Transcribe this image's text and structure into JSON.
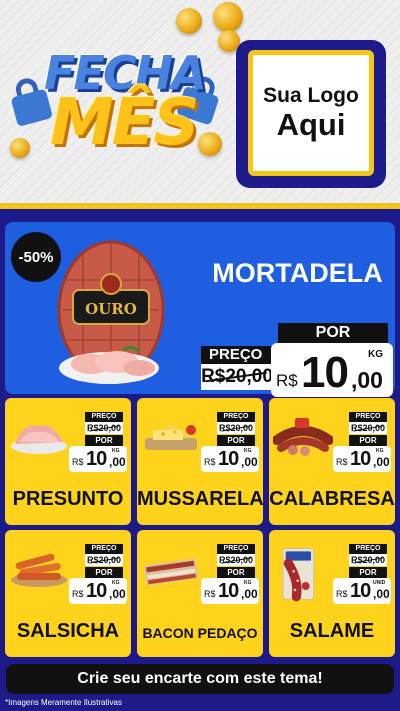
{
  "header": {
    "title_line1": "FECHA",
    "title_line2": "MÊS",
    "logo_line1": "Sua Logo",
    "logo_line2": "Aqui"
  },
  "featured": {
    "discount": "-50%",
    "name": "MORTADELA",
    "brand_label": "OURO",
    "preco_label": "PREÇO",
    "old_price": "R$20,00",
    "por_label": "POR",
    "currency": "R$",
    "price_int": "10",
    "price_dec": ",00",
    "unit": "KG"
  },
  "products": [
    {
      "name": "PRESUNTO",
      "preco_label": "PREÇO",
      "old_price": "R$20,00",
      "por_label": "POR",
      "currency": "R$",
      "price_int": "10",
      "price_dec": ",00",
      "unit": "KG"
    },
    {
      "name": "MUSSARELA",
      "preco_label": "PREÇO",
      "old_price": "R$20,00",
      "por_label": "POR",
      "currency": "R$",
      "price_int": "10",
      "price_dec": ",00",
      "unit": "KG"
    },
    {
      "name": "CALABRESA",
      "preco_label": "PREÇO",
      "old_price": "R$20,00",
      "por_label": "POR",
      "currency": "R$",
      "price_int": "10",
      "price_dec": ",00",
      "unit": "KG"
    },
    {
      "name": "SALSICHA",
      "preco_label": "PREÇO",
      "old_price": "R$20,00",
      "por_label": "POR",
      "currency": "R$",
      "price_int": "10",
      "price_dec": ",00",
      "unit": "KG"
    },
    {
      "name": "BACON PEDAÇO",
      "preco_label": "PREÇO",
      "old_price": "R$20,00",
      "por_label": "POR",
      "currency": "R$",
      "price_int": "10",
      "price_dec": ",00",
      "unit": "KG"
    },
    {
      "name": "SALAME",
      "preco_label": "PREÇO",
      "old_price": "R$20,00",
      "por_label": "POR",
      "currency": "R$",
      "price_int": "10",
      "price_dec": ",00",
      "unit": "UNID"
    }
  ],
  "cta": "Crie seu encarte com este tema!",
  "disclaimer": "*Imagens Meramente Ilustrativas",
  "colors": {
    "navy": "#1d1b8a",
    "blue": "#1f5ee0",
    "yellow": "#ffd21c",
    "black": "#111111"
  }
}
